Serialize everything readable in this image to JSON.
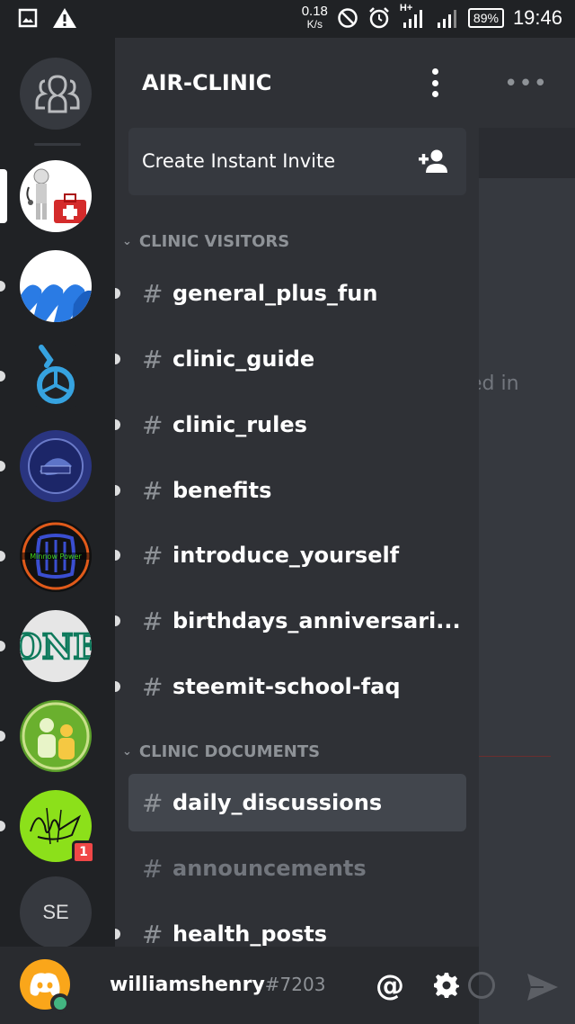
{
  "status_bar": {
    "net_speed": "0.18",
    "net_unit": "K/s",
    "network": "H+",
    "battery": "89%",
    "time": "19:46"
  },
  "server": {
    "name": "AIR-CLINIC",
    "invite_label": "Create Instant Invite"
  },
  "categories": [
    {
      "name": "CLINIC VISITORS",
      "channels": [
        {
          "name": "general_plus_fun",
          "unread": true
        },
        {
          "name": "clinic_guide",
          "unread": true
        },
        {
          "name": "clinic_rules",
          "unread": true
        },
        {
          "name": "benefits",
          "unread": true
        },
        {
          "name": "introduce_yourself",
          "unread": true
        },
        {
          "name": "birthdays_anniversari...",
          "unread": true
        },
        {
          "name": "steemit-school-faq",
          "unread": true
        }
      ]
    },
    {
      "name": "CLINIC DOCUMENTS",
      "channels": [
        {
          "name": "daily_discussions",
          "selected": true
        },
        {
          "name": "announcements",
          "muted": true
        },
        {
          "name": "health_posts",
          "unread": true
        }
      ]
    }
  ],
  "rail": {
    "badge_count": "1",
    "se_label": "SE",
    "servers": [
      "air-clinic",
      "waves",
      "bitshares",
      "blue-badge",
      "minnow-powerup",
      "one",
      "people",
      "signature"
    ]
  },
  "user": {
    "name": "williamshenry",
    "discriminator": "#7203",
    "mention_symbol": "@"
  },
  "main_peek": {
    "text": "ed in"
  },
  "colors": {
    "rail_bg": "#202225",
    "drawer_bg": "#2f3136",
    "selected_bg": "#42464d",
    "online": "#43b581",
    "badge": "#f04747",
    "avatar": "#faa61a"
  }
}
